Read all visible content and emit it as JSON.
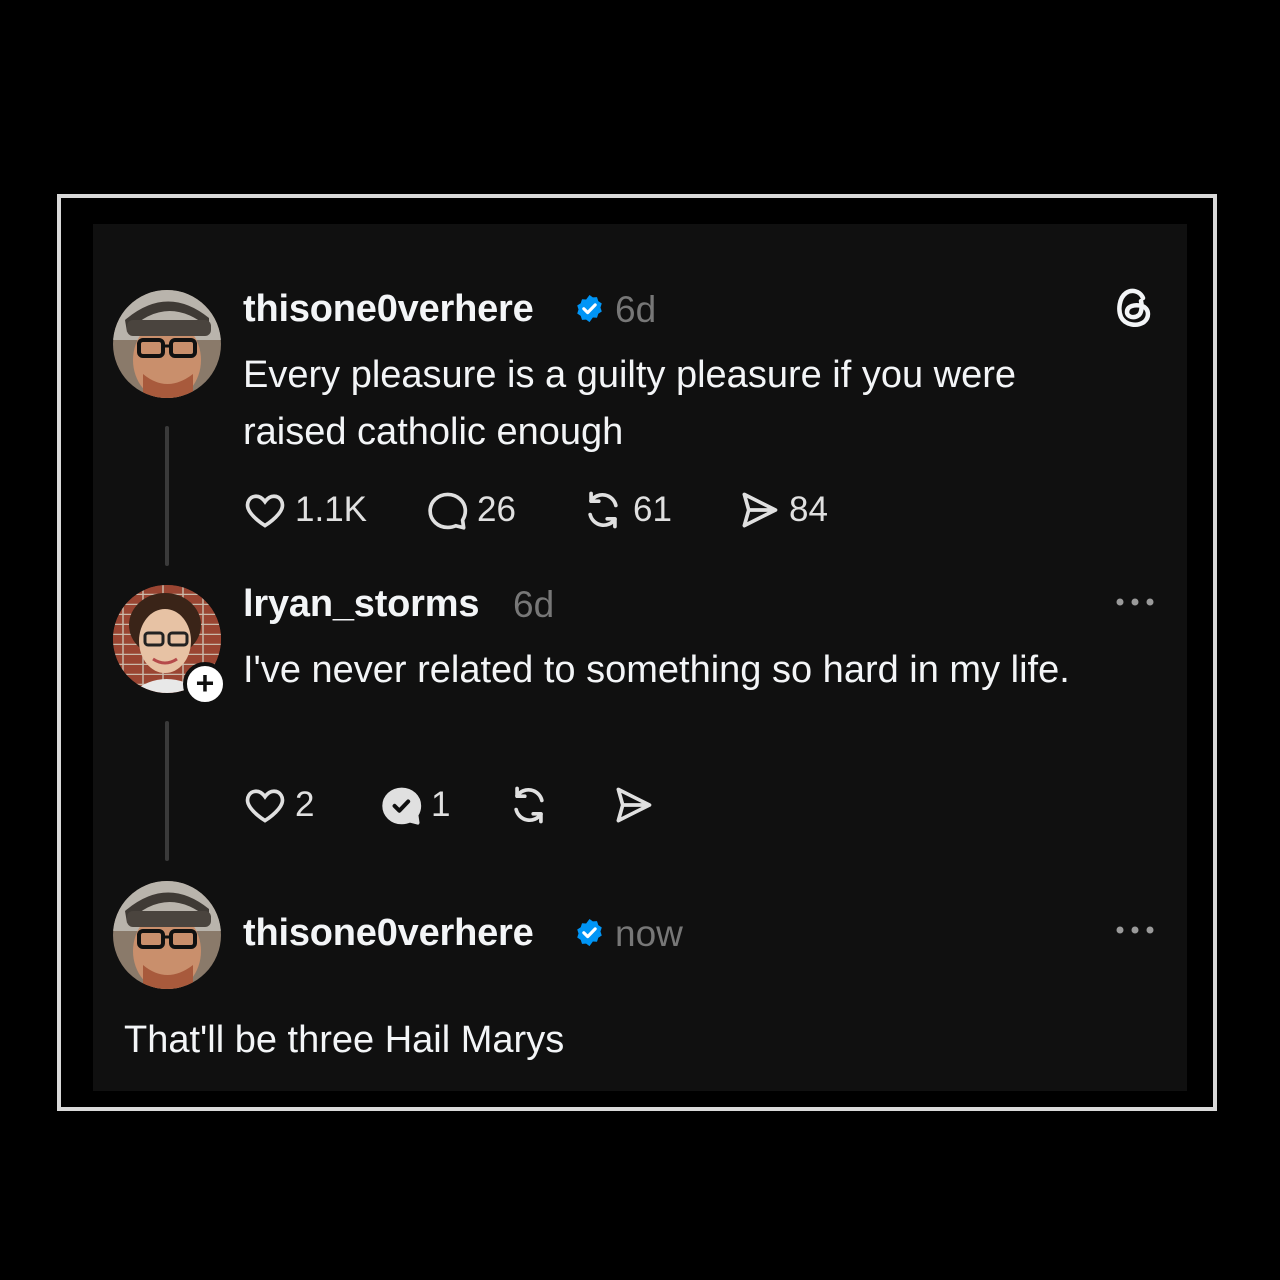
{
  "post": {
    "username": "thisone0verhere",
    "verified": true,
    "timestamp": "6d",
    "text": "Every pleasure is a guilty pleasure if you were raised catholic enough",
    "likes": "1.1K",
    "replies": "26",
    "reposts": "61",
    "shares": "84",
    "logo_icon": "threads-logo-icon"
  },
  "reply": {
    "username": "lryan_storms",
    "timestamp": "6d",
    "text": "I've never related to something so hard in my life.",
    "likes": "2",
    "replies": "1"
  },
  "response": {
    "username": "thisone0verhere",
    "verified": true,
    "timestamp": "now",
    "text": "That'll be three Hail Marys"
  },
  "colors": {
    "background": "#000000",
    "card": "#101010",
    "text": "#f3f5f7",
    "muted": "#777777",
    "verified": "#0095f6"
  }
}
